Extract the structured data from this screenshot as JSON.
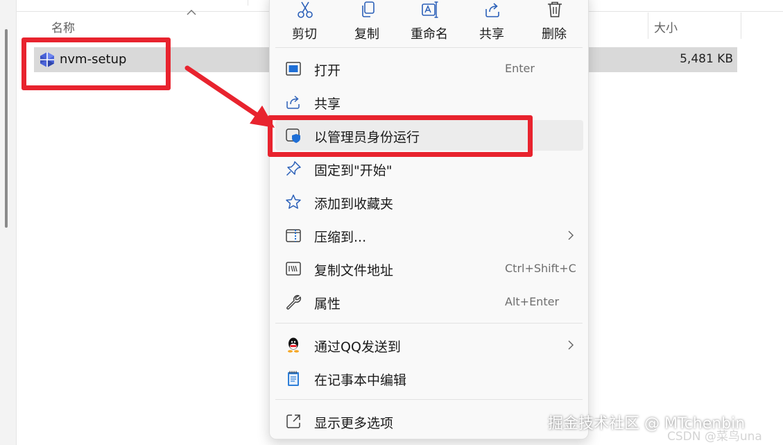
{
  "explorer": {
    "columns": {
      "name": "名称",
      "size": "大小"
    },
    "file": {
      "name": "nvm-setup",
      "size": "5,481 KB",
      "icon": "nvm-installer-icon"
    }
  },
  "toolbar": [
    {
      "label": "剪切",
      "icon": "scissors-icon"
    },
    {
      "label": "复制",
      "icon": "copy-icon"
    },
    {
      "label": "重命名",
      "icon": "rename-icon"
    },
    {
      "label": "共享",
      "icon": "share-icon"
    },
    {
      "label": "删除",
      "icon": "trash-icon"
    }
  ],
  "menu": {
    "items": [
      {
        "label": "打开",
        "shortcut": "Enter",
        "icon": "open-window-icon"
      },
      {
        "label": "共享",
        "shortcut": "",
        "icon": "share-icon"
      },
      {
        "label": "以管理员身份运行",
        "shortcut": "",
        "icon": "admin-shield-icon"
      },
      {
        "label": "固定到\"开始\"",
        "shortcut": "",
        "icon": "pin-icon"
      },
      {
        "label": "添加到收藏夹",
        "shortcut": "",
        "icon": "star-icon"
      },
      {
        "label": "压缩到...",
        "shortcut": "",
        "icon": "zip-icon",
        "submenu": true
      },
      {
        "label": "复制文件地址",
        "shortcut": "Ctrl+Shift+C",
        "icon": "copy-path-icon"
      },
      {
        "label": "属性",
        "shortcut": "Alt+Enter",
        "icon": "wrench-icon"
      }
    ],
    "extra_items": [
      {
        "label": "通过QQ发送到",
        "icon": "qq-icon",
        "submenu": true
      },
      {
        "label": "在记事本中编辑",
        "icon": "notepad-icon"
      }
    ],
    "more_options": {
      "label": "显示更多选项",
      "icon": "expand-icon"
    }
  },
  "annotation": {
    "color": "#e8232e"
  },
  "watermark": {
    "text": "掘金技术社区 @ MTchenbin",
    "text2": "CSDN @菜鸟una"
  }
}
